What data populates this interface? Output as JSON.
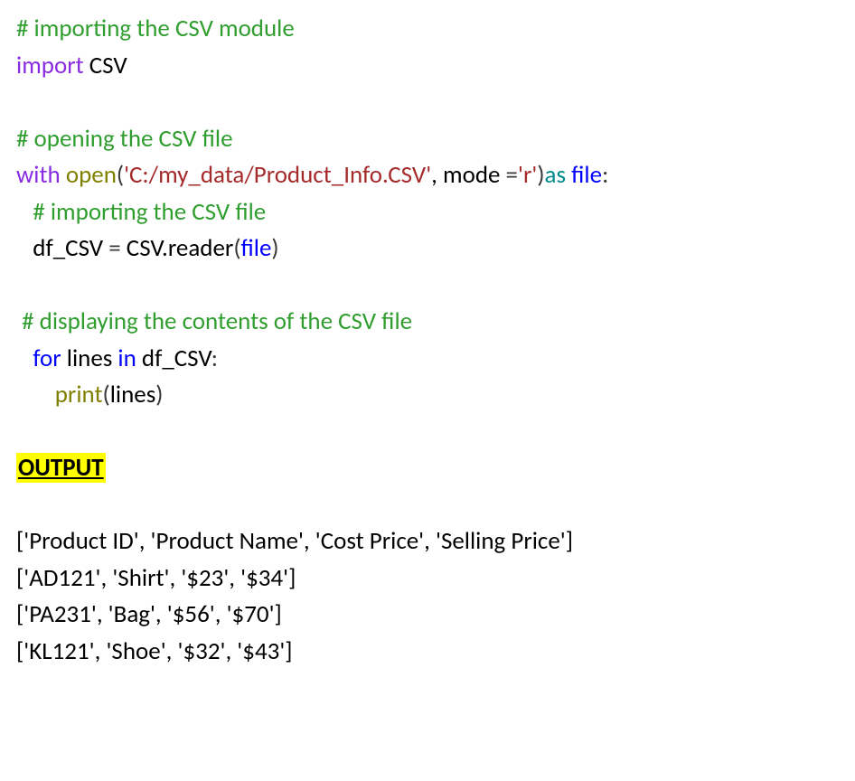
{
  "code": {
    "c1": "# importing the CSV module",
    "l2_import": "import ",
    "l2_csv": "CSV",
    "c3": "# opening the CSV file",
    "l4_with": "with",
    "l4_open": "open",
    "l4_lp": "(",
    "l4_path": "'C:/my_data/Product_Info.CSV'",
    "l4_comma_mode": ", mode ",
    "l4_eq": "=",
    "l4_r": "'r'",
    "l4_rp": ")",
    "l4_as": "as ",
    "l4_file": "file",
    "l4_colon": ":",
    "c5": "   # importing the CSV file",
    "l6_pre": "   df_CSV ",
    "l6_eq": "= ",
    "l6_csvreader": "CSV.reader",
    "l6_lp": "(",
    "l6_file": "file",
    "l6_rp": ")",
    "c7": " # displaying the contents of the CSV file",
    "l8_indent": "   ",
    "l8_for": "for",
    "l8_lines": " lines ",
    "l8_in": "in",
    "l8_dfcsv": " df_CSV",
    "l8_colon": ":",
    "l9_indent": "       ",
    "l9_print": "print",
    "l9_lp": "(",
    "l9_lines": "lines",
    "l9_rp": ")"
  },
  "output": {
    "label": "OUTPUT",
    "rows": [
      "['Product ID', 'Product Name', 'Cost Price', 'Selling Price']",
      "['AD121', 'Shirt', '$23', '$34']",
      "['PA231', 'Bag', '$56', '$70']",
      "['KL121', 'Shoe', '$32', '$43']"
    ]
  },
  "chart_data": {
    "type": "table",
    "columns": [
      "Product ID",
      "Product Name",
      "Cost Price",
      "Selling Price"
    ],
    "rows": [
      [
        "AD121",
        "Shirt",
        "$23",
        "$34"
      ],
      [
        "PA231",
        "Bag",
        "$56",
        "$70"
      ],
      [
        "KL121",
        "Shoe",
        "$32",
        "$43"
      ]
    ]
  }
}
